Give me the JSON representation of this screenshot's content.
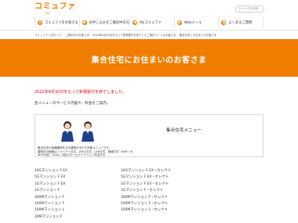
{
  "header": {
    "logo": "コミュファ",
    "logo_sub": "ctc",
    "search_placeholder": "サイト内を検索"
  },
  "nav": [
    {
      "label": "コミュファをお客さま",
      "icon": "user-icon"
    },
    {
      "label": "お申し込みをご検討中の方",
      "icon": "document-icon"
    },
    {
      "label": "Myコミュファ",
      "icon": "person-icon"
    },
    {
      "label": "Webメール",
      "icon": "mail-icon"
    },
    {
      "label": "よくあるご質問",
      "icon": "question-icon"
    }
  ],
  "breadcrumb": [
    "コミュファ 公式サイト",
    "ご契約中のお客さま",
    "2024年6月30日をもって新規受付を終了したご契約コースのお客さま",
    "集合住宅にお住まいのお客さま"
  ],
  "banner": {
    "title": "集合住宅にお住まいのお客さま"
  },
  "notice": "2022年6月30日をもって新規受付を終了しました。",
  "intro": "各メニューのサービス内容や、料金をご案内。",
  "menu": {
    "title": "集合住宅メニュー",
    "desc_lines": [
      "集合住宅の各種建物を主な建物の中から対象メニューです。",
      "建物内の配線はファイバー方式、VDSL方式、LAN方式、無線方式（WiFi）の",
      "Wi-Fi対応「Club」対応のホームゲートウェイ貸出付き"
    ]
  },
  "plans": {
    "left": [
      "10Gマンション F EX",
      "5Gマンション F EX",
      "1Gマンション F EX",
      "1Gマンション F",
      "300Mマンション F",
      "100Mマンション F",
      "100Mマンション L",
      "30Mマンション F"
    ],
    "right": [
      "10Gマンション F EX・セレクト",
      "5Gマンション F EX・セレクト",
      "1Gマンション F EX・セレクト",
      "1Gマンション F・セレクト",
      "300Mマンション F・セレクト",
      "100Mマンション F・セレクト",
      "100Mマンション L・セレクト"
    ]
  },
  "colors": {
    "accent": "#f07d00",
    "notice": "#e60012"
  }
}
